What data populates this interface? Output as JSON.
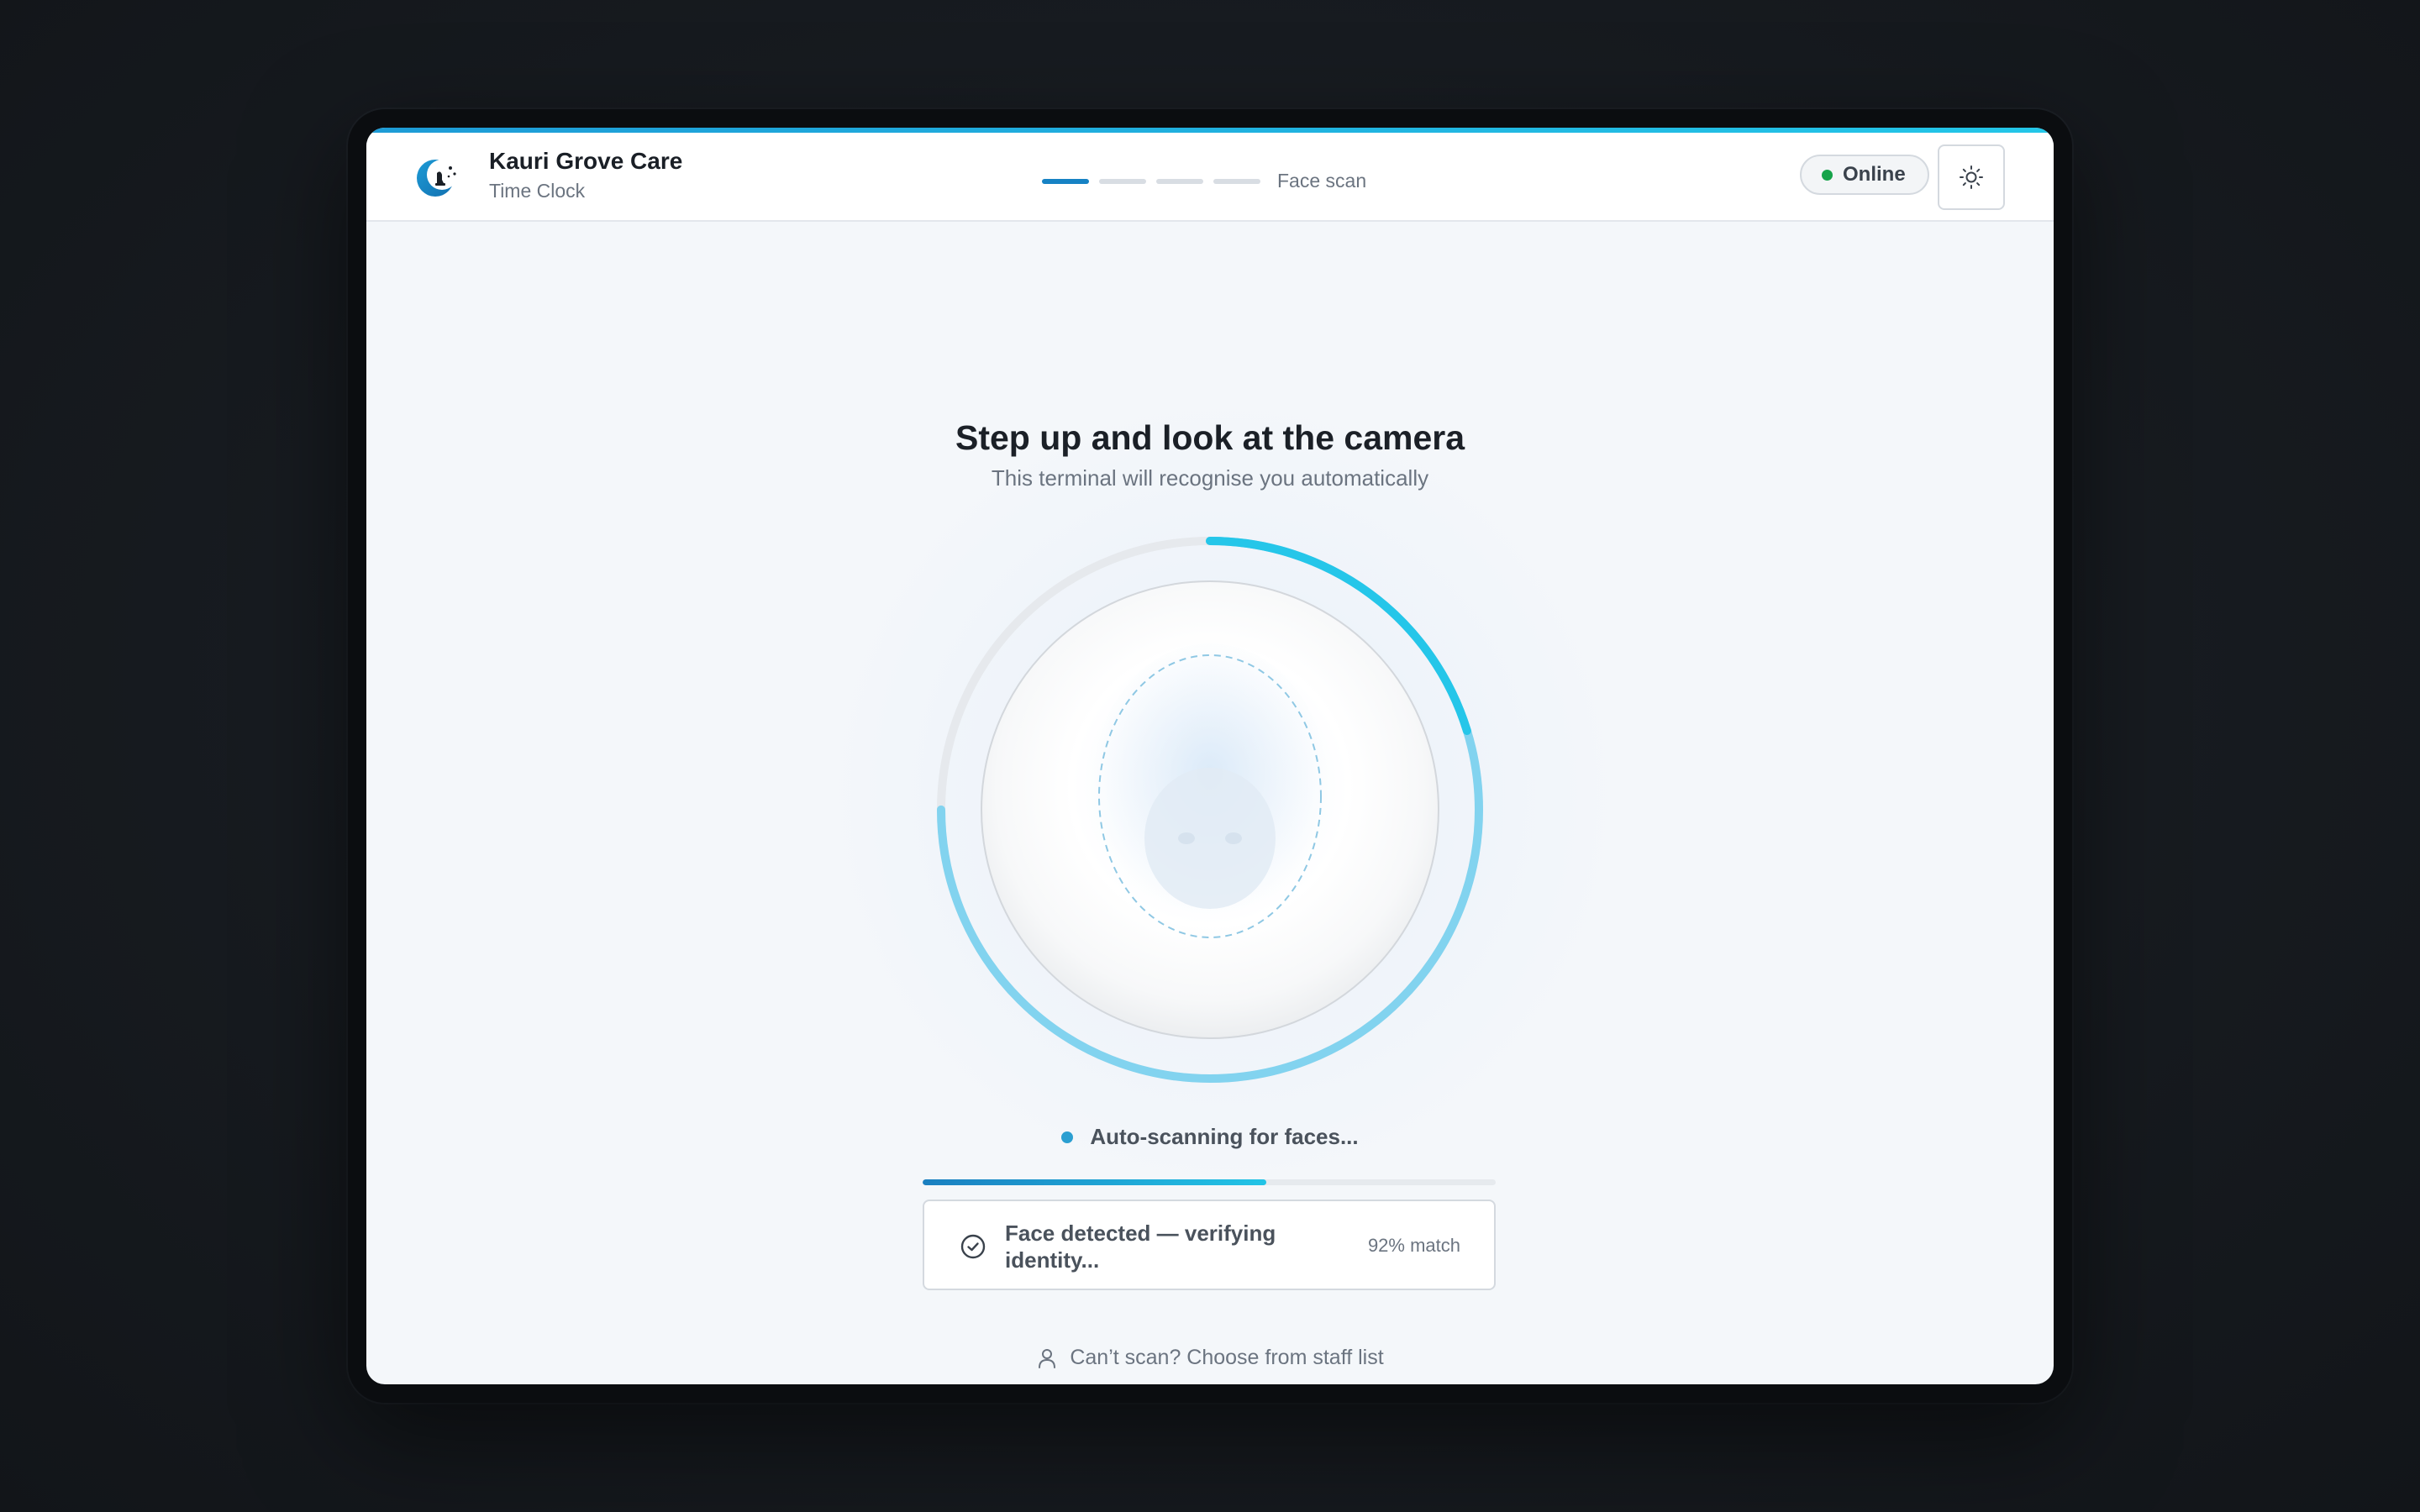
{
  "header": {
    "brand_name": "Kauri Grove Care",
    "brand_sub": "Time Clock",
    "step_label": "Face scan",
    "steps_total": 4,
    "step_current": 1,
    "status": "Online",
    "icons": {
      "logo": "moon-bell-logo",
      "theme": "sun-icon"
    }
  },
  "main": {
    "title": "Step up and look at the camera",
    "subtitle": "This terminal will recognise you automatically",
    "scanner": {
      "ring_progress": 0.75
    },
    "scan_status": "Auto-scanning for faces...",
    "scan_progress": 0.6,
    "result": {
      "text": "Face detected — verifying identity...",
      "match": "92% match",
      "icon": "check-circle-icon"
    },
    "fallback": {
      "text": "Can’t scan? Choose from staff list",
      "icon": "person-icon"
    }
  },
  "colors": {
    "accent": "#1682c4",
    "accent_light": "#22c4e6",
    "online": "#16a34a",
    "text_primary": "#1b2027",
    "text_muted": "#6b7480"
  }
}
